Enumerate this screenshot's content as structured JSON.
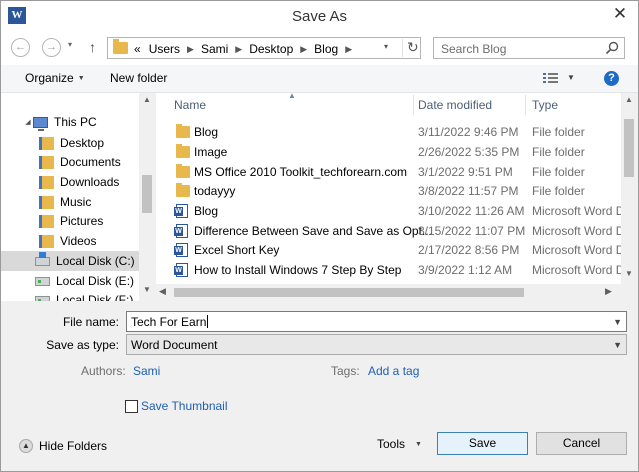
{
  "window": {
    "app_icon": "W",
    "title": "Save As",
    "close_symbol": "✕"
  },
  "navigation": {
    "back_symbol": "←",
    "forward_symbol": "→",
    "recent_symbol": "▾",
    "up_symbol": "↑",
    "address_overflow": "«",
    "address_crumbs": [
      "Users",
      "Sami",
      "Desktop",
      "Blog"
    ],
    "address_dropdown_symbol": "▾",
    "refresh_symbol": "↻",
    "search_placeholder": "Search Blog"
  },
  "toolbar": {
    "organize_label": "Organize",
    "new_folder_label": "New folder",
    "help_symbol": "?"
  },
  "nav_pane": {
    "items": [
      {
        "label": "This PC",
        "icon": "computer-icon",
        "selected": false
      },
      {
        "label": "Desktop",
        "icon": "folder-icon",
        "selected": false
      },
      {
        "label": "Documents",
        "icon": "folder-icon",
        "selected": false
      },
      {
        "label": "Downloads",
        "icon": "folder-icon",
        "selected": false
      },
      {
        "label": "Music",
        "icon": "folder-icon",
        "selected": false
      },
      {
        "label": "Pictures",
        "icon": "folder-icon",
        "selected": false
      },
      {
        "label": "Videos",
        "icon": "folder-icon",
        "selected": false
      },
      {
        "label": "Local Disk (C:)",
        "icon": "os-disk-icon",
        "selected": true
      },
      {
        "label": "Local Disk (E:)",
        "icon": "disk-icon",
        "selected": false
      },
      {
        "label": "Local Disk (F:)",
        "icon": "disk-icon",
        "selected": false
      }
    ]
  },
  "file_list": {
    "columns": {
      "name": "Name",
      "date": "Date modified",
      "type": "Type"
    },
    "rows": [
      {
        "name": "Blog",
        "date": "3/11/2022 9:46 PM",
        "type": "File folder",
        "icon": "folder-icon"
      },
      {
        "name": "Image",
        "date": "2/26/2022 5:35 PM",
        "type": "File folder",
        "icon": "folder-icon"
      },
      {
        "name": "MS Office 2010 Toolkit_techforearn.com",
        "date": "3/1/2022 9:51 PM",
        "type": "File folder",
        "icon": "folder-icon"
      },
      {
        "name": "todayyy",
        "date": "3/8/2022 11:57 PM",
        "type": "File folder",
        "icon": "folder-icon"
      },
      {
        "name": "Blog",
        "date": "3/10/2022 11:26 AM",
        "type": "Microsoft Word D",
        "icon": "word-doc-icon"
      },
      {
        "name": "Difference Between Save and Save as Opt...",
        "date": "3/15/2022 11:07 PM",
        "type": "Microsoft Word D",
        "icon": "word-doc-icon"
      },
      {
        "name": "Excel Short Key",
        "date": "2/17/2022 8:56 PM",
        "type": "Microsoft Word D",
        "icon": "word-doc-icon"
      },
      {
        "name": "How to Install Windows 7 Step By Step",
        "date": "3/9/2022 1:12 AM",
        "type": "Microsoft Word D",
        "icon": "word-doc-icon"
      }
    ]
  },
  "form": {
    "file_name_label": "File name:",
    "file_name_value": "Tech For Earn",
    "save_type_label": "Save as type:",
    "save_type_value": "Word Document",
    "authors_label": "Authors:",
    "authors_value": "Sami",
    "tags_label": "Tags:",
    "tags_value": "Add a tag",
    "thumbnail_label": "Save Thumbnail"
  },
  "footer": {
    "hide_folders_label": "Hide Folders",
    "tools_label": "Tools",
    "save_label": "Save",
    "cancel_label": "Cancel"
  },
  "colors": {
    "word_brand": "#2b579a",
    "folder": "#e8b84d",
    "link": "#1e5fb4",
    "help": "#1e6bc6"
  }
}
